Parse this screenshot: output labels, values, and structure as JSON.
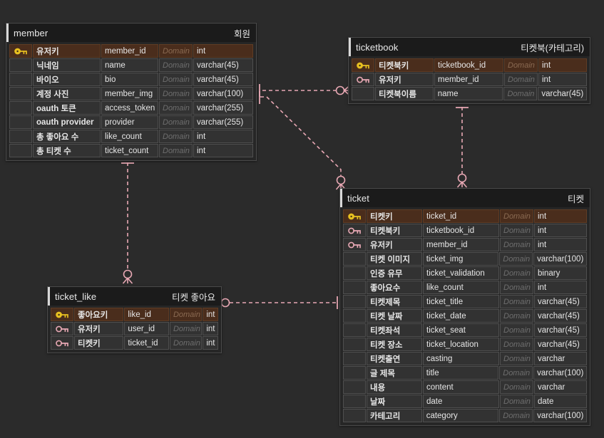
{
  "diagram": {
    "type": "erd",
    "notation": "crows-foot",
    "background": "#2b2b2b",
    "relation_color": "#e8a8b4",
    "pk_row_color": "#4a2d1c",
    "pk_key_color": "#e8c020",
    "fk_key_color": "#e8a8b4"
  },
  "entities": [
    {
      "id": "member",
      "physical_name": "member",
      "logical_name": "회원",
      "columns": [
        {
          "key": "pk",
          "logical": "유저키",
          "physical": "member_id",
          "domain": "Domain",
          "type": "int"
        },
        {
          "key": "",
          "logical": "닉네임",
          "physical": "name",
          "domain": "Domain",
          "type": "varchar(45)"
        },
        {
          "key": "",
          "logical": "바이오",
          "physical": "bio",
          "domain": "Domain",
          "type": "varchar(45)"
        },
        {
          "key": "",
          "logical": "계정 사진",
          "physical": "member_img",
          "domain": "Domain",
          "type": "varchar(100)"
        },
        {
          "key": "",
          "logical": "oauth 토큰",
          "physical": "access_token",
          "domain": "Domain",
          "type": "varchar(255)"
        },
        {
          "key": "",
          "logical": "oauth provider",
          "physical": "provider",
          "domain": "Domain",
          "type": "varchar(255)"
        },
        {
          "key": "",
          "logical": "총 좋아요 수",
          "physical": "like_count",
          "domain": "Domain",
          "type": "int"
        },
        {
          "key": "",
          "logical": "총 티켓 수",
          "physical": "ticket_count",
          "domain": "Domain",
          "type": "int"
        }
      ]
    },
    {
      "id": "ticketbook",
      "physical_name": "ticketbook",
      "logical_name": "티켓북(카테고리)",
      "columns": [
        {
          "key": "pk",
          "logical": "티켓북키",
          "physical": "ticketbook_id",
          "domain": "Domain",
          "type": "int"
        },
        {
          "key": "fk",
          "logical": "유저키",
          "physical": "member_id",
          "domain": "Domain",
          "type": "int"
        },
        {
          "key": "",
          "logical": "티켓북이름",
          "physical": "name",
          "domain": "Domain",
          "type": "varchar(45)"
        }
      ]
    },
    {
      "id": "ticket",
      "physical_name": "ticket",
      "logical_name": "티켓",
      "columns": [
        {
          "key": "pk",
          "logical": "티켓키",
          "physical": "ticket_id",
          "domain": "Domain",
          "type": "int"
        },
        {
          "key": "fk",
          "logical": "티켓북키",
          "physical": "ticketbook_id",
          "domain": "Domain",
          "type": "int"
        },
        {
          "key": "fk",
          "logical": "유저키",
          "physical": "member_id",
          "domain": "Domain",
          "type": "int"
        },
        {
          "key": "",
          "logical": "티켓 이미지",
          "physical": "ticket_img",
          "domain": "Domain",
          "type": "varchar(100)"
        },
        {
          "key": "",
          "logical": "인증 유무",
          "physical": "ticket_validation",
          "domain": "Domain",
          "type": "binary"
        },
        {
          "key": "",
          "logical": "좋아요수",
          "physical": "like_count",
          "domain": "Domain",
          "type": "int"
        },
        {
          "key": "",
          "logical": "티켓제목",
          "physical": "ticket_title",
          "domain": "Domain",
          "type": "varchar(45)"
        },
        {
          "key": "",
          "logical": "티켓 날짜",
          "physical": "ticket_date",
          "domain": "Domain",
          "type": "varchar(45)"
        },
        {
          "key": "",
          "logical": "티켓좌석",
          "physical": "ticket_seat",
          "domain": "Domain",
          "type": "varchar(45)"
        },
        {
          "key": "",
          "logical": "티켓 장소",
          "physical": "ticket_location",
          "domain": "Domain",
          "type": "varchar(45)"
        },
        {
          "key": "",
          "logical": "티켓출연",
          "physical": "casting",
          "domain": "Domain",
          "type": "varchar"
        },
        {
          "key": "",
          "logical": "글 제목",
          "physical": "title",
          "domain": "Domain",
          "type": "varchar(100)"
        },
        {
          "key": "",
          "logical": "내용",
          "physical": "content",
          "domain": "Domain",
          "type": "varchar"
        },
        {
          "key": "",
          "logical": "날짜",
          "physical": "date",
          "domain": "Domain",
          "type": "date"
        },
        {
          "key": "",
          "logical": "카테고리",
          "physical": "category",
          "domain": "Domain",
          "type": "varchar(100)"
        }
      ]
    },
    {
      "id": "ticket_like",
      "physical_name": "ticket_like",
      "logical_name": "티켓 좋아요",
      "columns": [
        {
          "key": "pk",
          "logical": "좋아요키",
          "physical": "like_id",
          "domain": "Domain",
          "type": "int"
        },
        {
          "key": "fk",
          "logical": "유저키",
          "physical": "user_id",
          "domain": "Domain",
          "type": "int"
        },
        {
          "key": "fk",
          "logical": "티켓키",
          "physical": "ticket_id",
          "domain": "Domain",
          "type": "int"
        }
      ]
    }
  ],
  "relationships": [
    {
      "id": "rel-member-ticketbook",
      "from": "member",
      "to": "ticketbook",
      "from_cardinality": "one",
      "to_cardinality": "zero-or-many",
      "identifying": false
    },
    {
      "id": "rel-member-ticket",
      "from": "member",
      "to": "ticket",
      "from_cardinality": "one",
      "to_cardinality": "zero-or-many",
      "identifying": false
    },
    {
      "id": "rel-member-ticketlike",
      "from": "member",
      "to": "ticket_like",
      "from_cardinality": "one",
      "to_cardinality": "zero-or-many",
      "identifying": false
    },
    {
      "id": "rel-ticketbook-ticket",
      "from": "ticketbook",
      "to": "ticket",
      "from_cardinality": "one",
      "to_cardinality": "zero-or-many",
      "identifying": false
    },
    {
      "id": "rel-ticket-ticketlike",
      "from": "ticket",
      "to": "ticket_like",
      "from_cardinality": "one",
      "to_cardinality": "zero-or-many",
      "identifying": false
    }
  ]
}
